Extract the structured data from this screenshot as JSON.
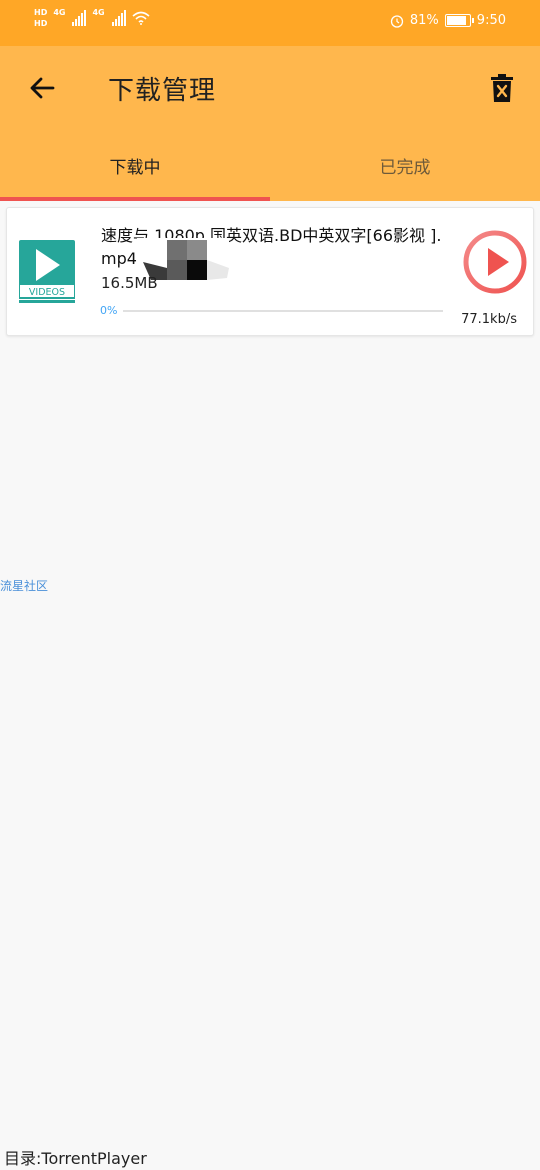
{
  "status_bar": {
    "hd1": "HD",
    "hd2": "HD",
    "net1": "4G",
    "net2": "4G",
    "battery_percent": "81%",
    "time": "9:50"
  },
  "app_bar": {
    "title": "下载管理"
  },
  "tabs": [
    {
      "label": "下载中",
      "active": true
    },
    {
      "label": "已完成",
      "active": false
    }
  ],
  "download": {
    "filename": "速度与 1080p.国英双语.BD中英双字[66影视 ].mp4",
    "size": "16.5MB",
    "progress_text": "0%",
    "progress": 0,
    "speed": "77.1kb/s",
    "thumbnail_label": "VIDEOS"
  },
  "watermark_link": "流星社区",
  "footer": "目录:TorrentPlayer",
  "colors": {
    "status_bar": "#ffa726",
    "app_bar": "#ffb74d",
    "tab_indicator": "#ef5350",
    "video_icon": "#26a69a",
    "play_button": "#ef5350",
    "progress": "#42a5f5"
  }
}
